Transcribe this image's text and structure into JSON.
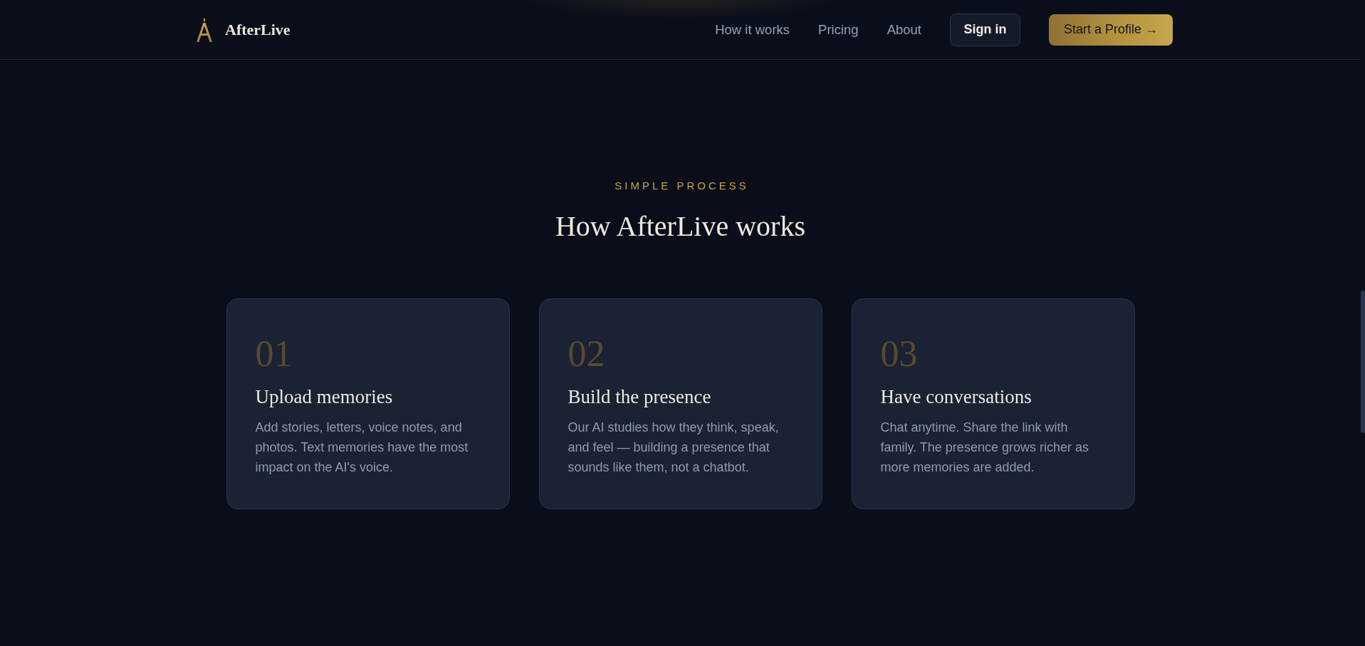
{
  "header": {
    "brand": "AfterLive",
    "nav_links": [
      {
        "label": "How it works"
      },
      {
        "label": "Pricing"
      },
      {
        "label": "About"
      }
    ],
    "buttons": [
      {
        "kind": "secondary",
        "label": "Sign in"
      },
      {
        "kind": "primary",
        "label": "Start a Profile →"
      }
    ]
  },
  "section": {
    "eyebrow": "SIMPLE PROCESS",
    "title": "How AfterLive works",
    "steps": [
      {
        "number": "01",
        "title": "Upload memories",
        "description": "Add stories, letters, voice notes, and photos. Text memories have the most impact on the AI's voice."
      },
      {
        "number": "02",
        "title": "Build the presence",
        "description": "Our AI studies how they think, speak, and feel — building a presence that sounds like them, not a chatbot."
      },
      {
        "number": "03",
        "title": "Have conversations",
        "description": "Chat anytime. Share the link with family. The presence grows richer as more memories are added."
      }
    ]
  }
}
